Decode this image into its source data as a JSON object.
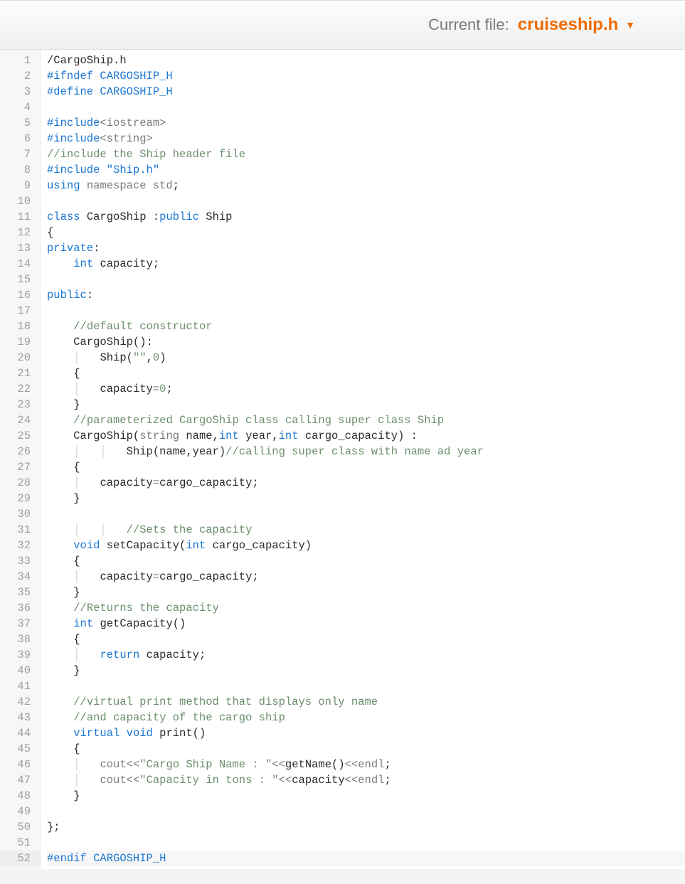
{
  "header": {
    "label": "Current file:",
    "filename": "cruiseship.h"
  },
  "colors": {
    "accent": "#ef6c00",
    "keyword": "#1976d2",
    "comment": "#6b8e6b",
    "muted": "#7b7b7b"
  },
  "code": {
    "lines": [
      {
        "n": 1,
        "segs": [
          {
            "t": "/CargoShip.h",
            "c": "id"
          }
        ]
      },
      {
        "n": 2,
        "segs": [
          {
            "t": "#ifndef CARGOSHIP_H",
            "c": "pp"
          }
        ]
      },
      {
        "n": 3,
        "segs": [
          {
            "t": "#define CARGOSHIP_H",
            "c": "pp"
          }
        ]
      },
      {
        "n": 4,
        "segs": []
      },
      {
        "n": 5,
        "segs": [
          {
            "t": "#include",
            "c": "pp"
          },
          {
            "t": "<iostream>",
            "c": "type"
          }
        ]
      },
      {
        "n": 6,
        "segs": [
          {
            "t": "#include",
            "c": "pp"
          },
          {
            "t": "<string>",
            "c": "type"
          }
        ]
      },
      {
        "n": 7,
        "segs": [
          {
            "t": "//include the Ship header file",
            "c": "com"
          }
        ]
      },
      {
        "n": 8,
        "segs": [
          {
            "t": "#include \"Ship.h\"",
            "c": "pp"
          }
        ]
      },
      {
        "n": 9,
        "segs": [
          {
            "t": "using ",
            "c": "kw"
          },
          {
            "t": "namespace ",
            "c": "type"
          },
          {
            "t": "std",
            "c": "type"
          },
          {
            "t": ";",
            "c": "id"
          }
        ]
      },
      {
        "n": 10,
        "segs": []
      },
      {
        "n": 11,
        "segs": [
          {
            "t": "class ",
            "c": "kw"
          },
          {
            "t": "CargoShip ",
            "c": "id"
          },
          {
            "t": ":",
            "c": "id"
          },
          {
            "t": "public ",
            "c": "kw"
          },
          {
            "t": "Ship",
            "c": "id"
          }
        ]
      },
      {
        "n": 12,
        "segs": [
          {
            "t": "{",
            "c": "id"
          }
        ]
      },
      {
        "n": 13,
        "segs": [
          {
            "t": "private",
            "c": "kw"
          },
          {
            "t": ":",
            "c": "id"
          }
        ]
      },
      {
        "n": 14,
        "segs": [
          {
            "t": "    ",
            "c": "id"
          },
          {
            "t": "int ",
            "c": "kw"
          },
          {
            "t": "capacity;",
            "c": "id"
          }
        ]
      },
      {
        "n": 15,
        "segs": []
      },
      {
        "n": 16,
        "segs": [
          {
            "t": "public",
            "c": "kw"
          },
          {
            "t": ":",
            "c": "id"
          }
        ]
      },
      {
        "n": 17,
        "segs": []
      },
      {
        "n": 18,
        "segs": [
          {
            "t": "    ",
            "c": "id"
          },
          {
            "t": "//default constructor",
            "c": "com"
          }
        ]
      },
      {
        "n": 19,
        "segs": [
          {
            "t": "    CargoShip():",
            "c": "id"
          }
        ]
      },
      {
        "n": 20,
        "segs": [
          {
            "t": "    ",
            "c": "id"
          },
          {
            "t": "│   ",
            "c": "guide"
          },
          {
            "t": "Ship(",
            "c": "id"
          },
          {
            "t": "\"\"",
            "c": "str"
          },
          {
            "t": ",",
            "c": "id"
          },
          {
            "t": "0",
            "c": "num"
          },
          {
            "t": ")",
            "c": "id"
          }
        ]
      },
      {
        "n": 21,
        "segs": [
          {
            "t": "    {",
            "c": "id"
          }
        ]
      },
      {
        "n": 22,
        "segs": [
          {
            "t": "    ",
            "c": "id"
          },
          {
            "t": "│   ",
            "c": "guide"
          },
          {
            "t": "capacity",
            "c": "id"
          },
          {
            "t": "=",
            "c": "op"
          },
          {
            "t": "0",
            "c": "num"
          },
          {
            "t": ";",
            "c": "id"
          }
        ]
      },
      {
        "n": 23,
        "segs": [
          {
            "t": "    }",
            "c": "id"
          }
        ]
      },
      {
        "n": 24,
        "segs": [
          {
            "t": "    ",
            "c": "id"
          },
          {
            "t": "//parameterized CargoShip class calling super class Ship",
            "c": "com"
          }
        ]
      },
      {
        "n": 25,
        "segs": [
          {
            "t": "    CargoShip(",
            "c": "id"
          },
          {
            "t": "string ",
            "c": "type"
          },
          {
            "t": "name,",
            "c": "id"
          },
          {
            "t": "int ",
            "c": "kw"
          },
          {
            "t": "year,",
            "c": "id"
          },
          {
            "t": "int ",
            "c": "kw"
          },
          {
            "t": "cargo_capacity) :",
            "c": "id"
          }
        ]
      },
      {
        "n": 26,
        "segs": [
          {
            "t": "    ",
            "c": "id"
          },
          {
            "t": "│   │   ",
            "c": "guide"
          },
          {
            "t": "Ship(name,year)",
            "c": "id"
          },
          {
            "t": "//calling super class with name ad year",
            "c": "com"
          }
        ]
      },
      {
        "n": 27,
        "segs": [
          {
            "t": "    {",
            "c": "id"
          }
        ]
      },
      {
        "n": 28,
        "segs": [
          {
            "t": "    ",
            "c": "id"
          },
          {
            "t": "│   ",
            "c": "guide"
          },
          {
            "t": "capacity",
            "c": "id"
          },
          {
            "t": "=",
            "c": "op"
          },
          {
            "t": "cargo_capacity;",
            "c": "id"
          }
        ]
      },
      {
        "n": 29,
        "segs": [
          {
            "t": "    }",
            "c": "id"
          }
        ]
      },
      {
        "n": 30,
        "segs": []
      },
      {
        "n": 31,
        "segs": [
          {
            "t": "    ",
            "c": "id"
          },
          {
            "t": "│   │   ",
            "c": "guide"
          },
          {
            "t": "//Sets the capacity",
            "c": "com"
          }
        ]
      },
      {
        "n": 32,
        "segs": [
          {
            "t": "    ",
            "c": "id"
          },
          {
            "t": "void ",
            "c": "kw"
          },
          {
            "t": "setCapacity(",
            "c": "id"
          },
          {
            "t": "int ",
            "c": "kw"
          },
          {
            "t": "cargo_capacity)",
            "c": "id"
          }
        ]
      },
      {
        "n": 33,
        "segs": [
          {
            "t": "    {",
            "c": "id"
          }
        ]
      },
      {
        "n": 34,
        "segs": [
          {
            "t": "    ",
            "c": "id"
          },
          {
            "t": "│   ",
            "c": "guide"
          },
          {
            "t": "capacity",
            "c": "id"
          },
          {
            "t": "=",
            "c": "op"
          },
          {
            "t": "cargo_capacity;",
            "c": "id"
          }
        ]
      },
      {
        "n": 35,
        "segs": [
          {
            "t": "    }",
            "c": "id"
          }
        ]
      },
      {
        "n": 36,
        "segs": [
          {
            "t": "    ",
            "c": "id"
          },
          {
            "t": "//Returns the capacity",
            "c": "com"
          }
        ]
      },
      {
        "n": 37,
        "segs": [
          {
            "t": "    ",
            "c": "id"
          },
          {
            "t": "int ",
            "c": "kw"
          },
          {
            "t": "getCapacity()",
            "c": "id"
          }
        ]
      },
      {
        "n": 38,
        "segs": [
          {
            "t": "    {",
            "c": "id"
          }
        ]
      },
      {
        "n": 39,
        "segs": [
          {
            "t": "    ",
            "c": "id"
          },
          {
            "t": "│   ",
            "c": "guide"
          },
          {
            "t": "return ",
            "c": "kw"
          },
          {
            "t": "capacity;",
            "c": "id"
          }
        ]
      },
      {
        "n": 40,
        "segs": [
          {
            "t": "    }",
            "c": "id"
          }
        ]
      },
      {
        "n": 41,
        "segs": []
      },
      {
        "n": 42,
        "segs": [
          {
            "t": "    ",
            "c": "id"
          },
          {
            "t": "//virtual print method that displays only name",
            "c": "com"
          }
        ]
      },
      {
        "n": 43,
        "segs": [
          {
            "t": "    ",
            "c": "id"
          },
          {
            "t": "//and capacity of the cargo ship",
            "c": "com"
          }
        ]
      },
      {
        "n": 44,
        "segs": [
          {
            "t": "    ",
            "c": "id"
          },
          {
            "t": "virtual ",
            "c": "kw"
          },
          {
            "t": "void ",
            "c": "kw"
          },
          {
            "t": "print()",
            "c": "id"
          }
        ]
      },
      {
        "n": 45,
        "segs": [
          {
            "t": "    {",
            "c": "id"
          }
        ]
      },
      {
        "n": 46,
        "segs": [
          {
            "t": "    ",
            "c": "id"
          },
          {
            "t": "│   ",
            "c": "guide"
          },
          {
            "t": "cout",
            "c": "type"
          },
          {
            "t": "<<",
            "c": "op"
          },
          {
            "t": "\"Cargo Ship Name : \"",
            "c": "str"
          },
          {
            "t": "<<",
            "c": "op"
          },
          {
            "t": "getName()",
            "c": "id"
          },
          {
            "t": "<<",
            "c": "op"
          },
          {
            "t": "endl",
            "c": "type"
          },
          {
            "t": ";",
            "c": "id"
          }
        ]
      },
      {
        "n": 47,
        "segs": [
          {
            "t": "    ",
            "c": "id"
          },
          {
            "t": "│   ",
            "c": "guide"
          },
          {
            "t": "cout",
            "c": "type"
          },
          {
            "t": "<<",
            "c": "op"
          },
          {
            "t": "\"Capacity in tons : \"",
            "c": "str"
          },
          {
            "t": "<<",
            "c": "op"
          },
          {
            "t": "capacity",
            "c": "id"
          },
          {
            "t": "<<",
            "c": "op"
          },
          {
            "t": "endl",
            "c": "type"
          },
          {
            "t": ";",
            "c": "id"
          }
        ]
      },
      {
        "n": 48,
        "segs": [
          {
            "t": "    }",
            "c": "id"
          }
        ]
      },
      {
        "n": 49,
        "segs": []
      },
      {
        "n": 50,
        "segs": [
          {
            "t": "};",
            "c": "id"
          }
        ]
      },
      {
        "n": 51,
        "segs": []
      },
      {
        "n": 52,
        "segs": [
          {
            "t": "#endif CARGOSHIP_H",
            "c": "pp"
          }
        ]
      }
    ]
  }
}
